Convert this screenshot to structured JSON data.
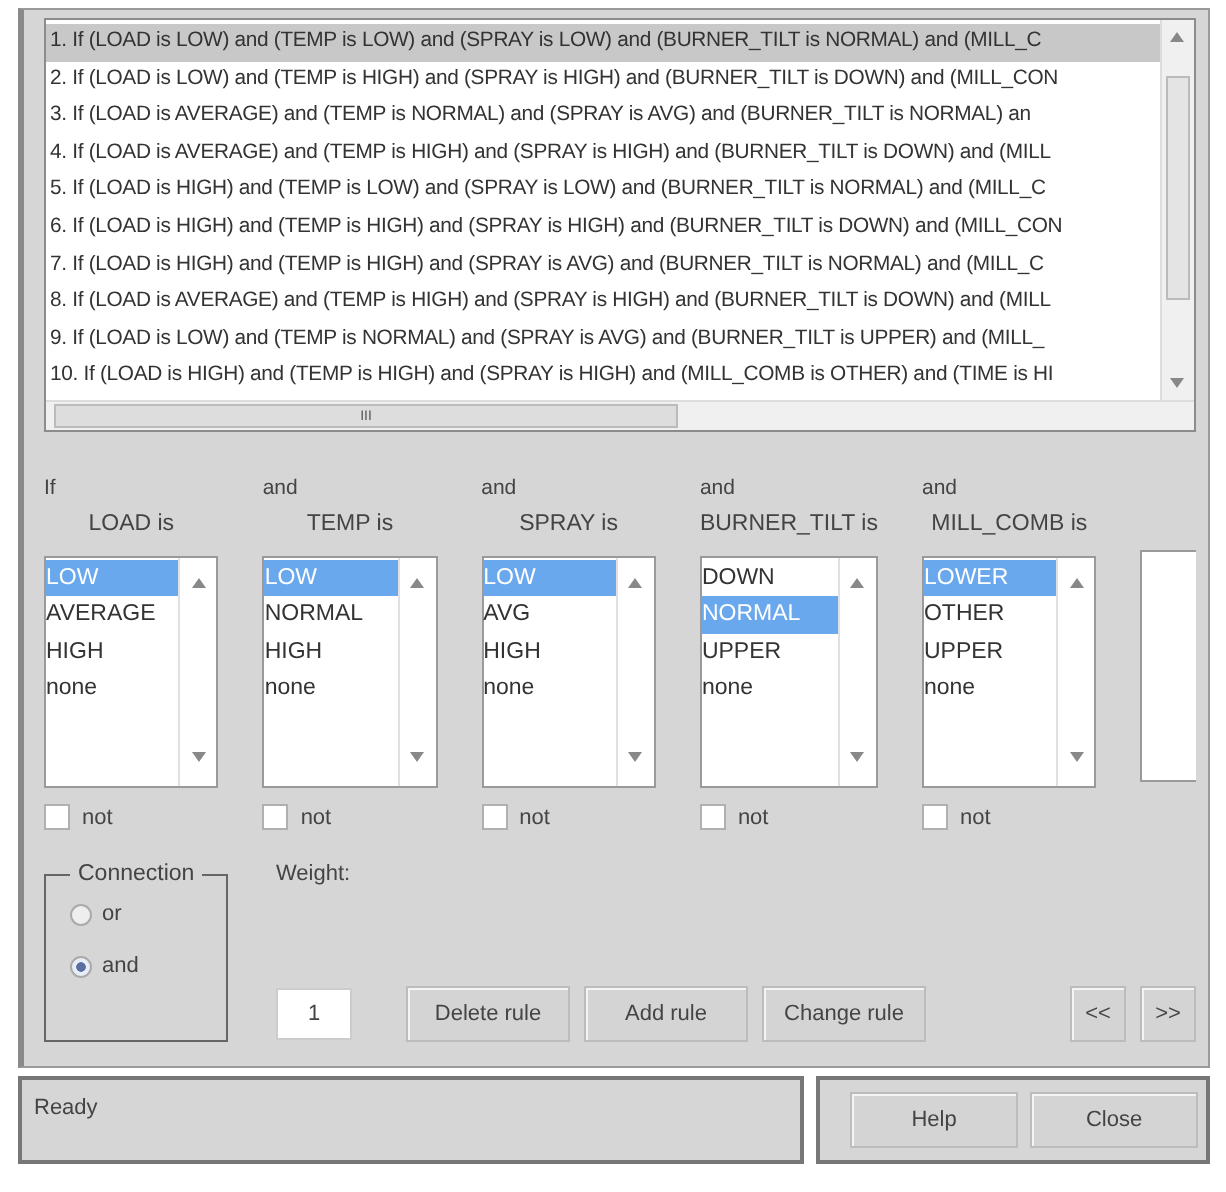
{
  "rules": [
    {
      "text": "1. If (LOAD is LOW) and (TEMP is LOW) and (SPRAY is LOW) and (BURNER_TILT is NORMAL) and (MILL_C",
      "selected": true
    },
    {
      "text": "2. If (LOAD is LOW) and (TEMP is HIGH) and (SPRAY is HIGH) and (BURNER_TILT is DOWN) and (MILL_CON",
      "selected": false
    },
    {
      "text": "3. If (LOAD is AVERAGE) and (TEMP is NORMAL) and (SPRAY is AVG) and (BURNER_TILT is NORMAL) an",
      "selected": false
    },
    {
      "text": "4. If (LOAD is AVERAGE) and (TEMP is HIGH) and (SPRAY is HIGH) and (BURNER_TILT is DOWN) and (MILL",
      "selected": false
    },
    {
      "text": "5. If (LOAD is HIGH) and (TEMP is LOW) and (SPRAY is LOW) and (BURNER_TILT is NORMAL) and (MILL_C",
      "selected": false
    },
    {
      "text": "6. If (LOAD is HIGH) and (TEMP is HIGH) and (SPRAY is HIGH) and (BURNER_TILT is DOWN) and (MILL_CON",
      "selected": false
    },
    {
      "text": "7. If (LOAD is HIGH) and (TEMP is HIGH) and (SPRAY is AVG) and (BURNER_TILT is NORMAL) and (MILL_C",
      "selected": false
    },
    {
      "text": "8. If (LOAD is AVERAGE) and (TEMP is HIGH) and (SPRAY is HIGH) and (BURNER_TILT is DOWN) and (MILL",
      "selected": false
    },
    {
      "text": "9. If (LOAD is LOW) and (TEMP is NORMAL) and (SPRAY is AVG) and (BURNER_TILT is UPPER) and (MILL_",
      "selected": false
    },
    {
      "text": "10. If (LOAD is HIGH) and (TEMP is HIGH) and (SPRAY is HIGH) and (MILL_COMB is OTHER) and (TIME is HI",
      "selected": false
    }
  ],
  "scroll_grip": "III",
  "inputs": [
    {
      "connector": "If",
      "variable": "LOAD is",
      "options": [
        {
          "label": "LOW",
          "selected": true
        },
        {
          "label": "AVERAGE",
          "selected": false
        },
        {
          "label": "HIGH",
          "selected": false
        },
        {
          "label": "none",
          "selected": false
        }
      ],
      "not_label": "not",
      "not_checked": false
    },
    {
      "connector": "and",
      "variable": "TEMP is",
      "options": [
        {
          "label": "LOW",
          "selected": true
        },
        {
          "label": "NORMAL",
          "selected": false
        },
        {
          "label": "HIGH",
          "selected": false
        },
        {
          "label": "none",
          "selected": false
        }
      ],
      "not_label": "not",
      "not_checked": false
    },
    {
      "connector": "and",
      "variable": "SPRAY is",
      "options": [
        {
          "label": "LOW",
          "selected": true
        },
        {
          "label": "AVG",
          "selected": false
        },
        {
          "label": "HIGH",
          "selected": false
        },
        {
          "label": "none",
          "selected": false
        }
      ],
      "not_label": "not",
      "not_checked": false
    },
    {
      "connector": "and",
      "variable": "BURNER_TILT is",
      "options": [
        {
          "label": "DOWN",
          "selected": false
        },
        {
          "label": "NORMAL",
          "selected": true
        },
        {
          "label": "UPPER",
          "selected": false
        },
        {
          "label": "none",
          "selected": false
        }
      ],
      "not_label": "not",
      "not_checked": false
    },
    {
      "connector": "and",
      "variable": "MILL_COMB is",
      "options": [
        {
          "label": "LOWER",
          "selected": true
        },
        {
          "label": "OTHER",
          "selected": false
        },
        {
          "label": "UPPER",
          "selected": false
        },
        {
          "label": "none",
          "selected": false
        }
      ],
      "not_label": "not",
      "not_checked": false
    }
  ],
  "connection": {
    "title": "Connection",
    "options": [
      {
        "label": "or",
        "selected": false
      },
      {
        "label": "and",
        "selected": true
      }
    ]
  },
  "weight": {
    "label": "Weight:",
    "value": "1"
  },
  "buttons": [
    "Delete rule",
    "Add rule",
    "Change rule"
  ],
  "nav_buttons": [
    "<<",
    ">>"
  ],
  "status": "Ready",
  "footer_buttons": [
    "Help",
    "Close"
  ]
}
